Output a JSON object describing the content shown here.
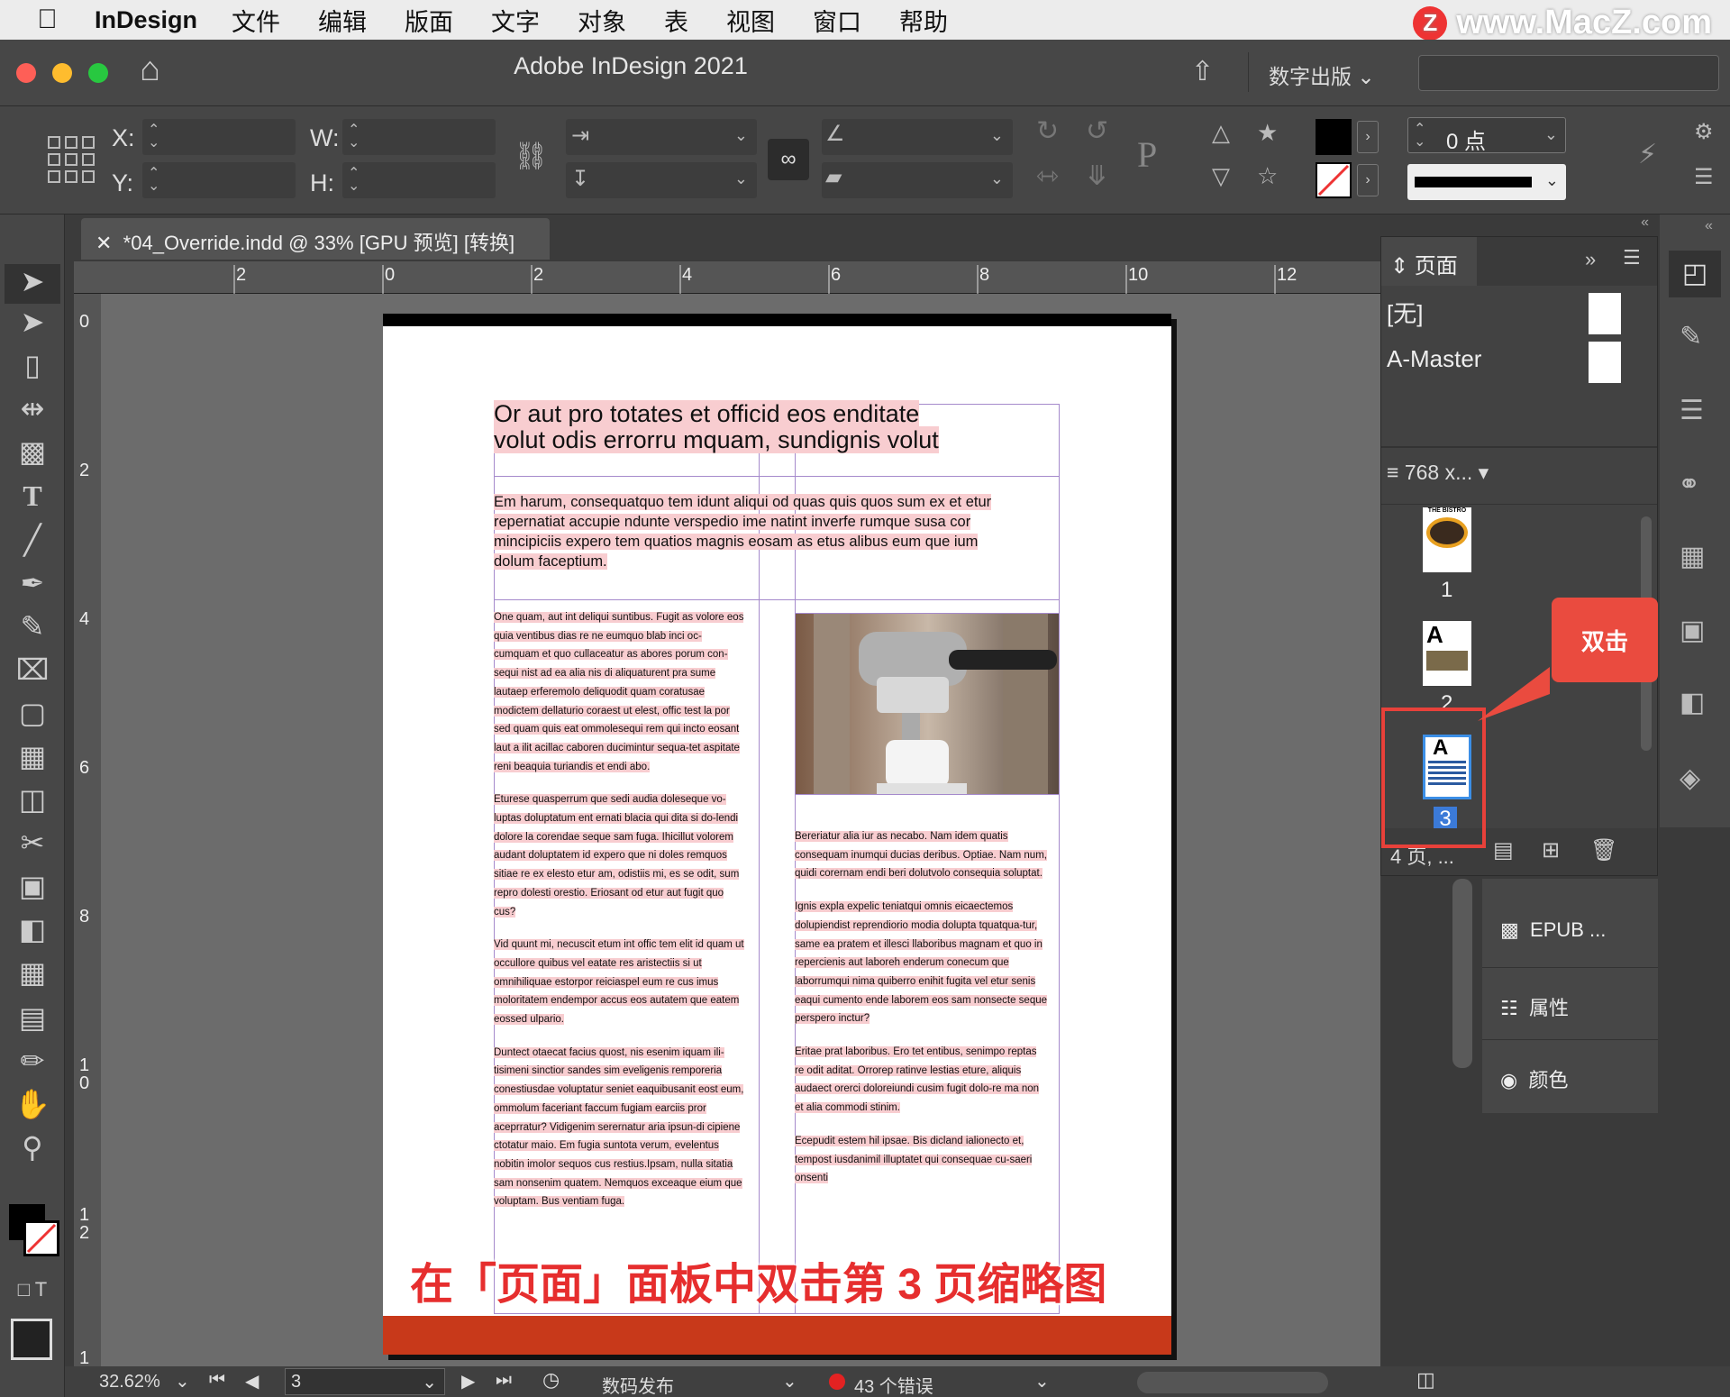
{
  "menubar": {
    "app": "InDesign",
    "items": [
      "文件",
      "编辑",
      "版面",
      "文字",
      "对象",
      "表",
      "视图",
      "窗口",
      "帮助"
    ]
  },
  "watermark": "www.MacZ.com",
  "titlebar": {
    "title": "Adobe InDesign 2021",
    "publish": "数字出版"
  },
  "control": {
    "x_label": "X:",
    "y_label": "Y:",
    "w_label": "W:",
    "h_label": "H:",
    "stroke_weight": "0 点",
    "proxy_letter": "P"
  },
  "document_tab": {
    "title": "*04_Override.indd @ 33% [GPU 预览] [转换]"
  },
  "ruler": {
    "h_labels": [
      "2",
      "0",
      "2",
      "4",
      "6",
      "8",
      "10",
      "12"
    ],
    "v_labels": [
      "0",
      "2",
      "4",
      "6",
      "8",
      "1\n0",
      "1\n2",
      "1"
    ]
  },
  "page": {
    "headline": "Or aut pro totates et officid eos enditate volut odis errorru mquam, sundignis volut",
    "intro": "Em harum, consequatquo tem idunt aliqui od quas quis quos sum ex et etur repernatiat accupie ndunte verspedio ime natint inverfe rumque susa cor mincipiciis expero tem quatios magnis eosam as etus alibus eum que ium dolum faceptium.",
    "col1_paras": [
      "One quam, aut int deliqui suntibus. Fugit as volore eos quia ventibus dias re ne eumquo blab inci oc-cumquam et quo cullaceatur as abores porum con-sequi nist ad ea alia nis di aliquaturent pra sume lautaep erferemolo deliquodit quam coratusae modictem dellaturio coraest ut elest, offic test la por sed quam quis eat ommolesequi rem qui incto eosant laut a ilit acillac caboren ducimintur sequa-tet aspitate reni beaquia turiandis et endi abo.",
      "Eturese quasperrum que sedi audia doleseque vo-luptas doluptatum ent ernati blacia qui dita si do-lendi dolore la corendae seque sam fuga. Ihicillut volorem audant doluptatem id expero que ni doles remquos sitiae re ex elesto etur am, odistiis mi, es se odit, sum repro dolesti orestio. Eriosant od etur aut fugit quo cus?",
      "Vid quunt mi, necuscit etum int offic tem elit id quam ut occullore quibus vel eatate res aristectiis si ut omnihiliquae estorpor reiciaspel eum re cus imus moloritatem endempor accus eos autatem que eatem eossed ulpario.",
      "Duntect otaecat facius quost, nis esenim iquam ili-tisimeni sinctior sandes sim eveligenis remporeria conestiusdae voluptatur seniet eaquibusanit eost eum, ommolum faceriant faccum fugiam earciis pror aceprratur? Vidigenim serernatur aria ipsun-di cipiene ctotatur maio. Em fugia suntota verum, evelentus nobitin imolor sequos cus restius.Ipsam, nulla sitatia sam nonsenim quatem. Nemquos exceaque eium que voluptam. Bus ventiam fuga."
    ],
    "col2_paras": [
      "Bereriatur alia iur as necabo. Nam idem quatis consequam inumqui ducias deribus. Optiae. Nam num, quidi corernam endi beri dolutvolo consequia soluptat.",
      "Ignis expla expelic teniatqui omnis eicaectemos dolupiendist reprendiorio modia dolupta tquatqua-tur, same ea pratem et illesci llaboribus magnam et quo in repercienis aut laboreh enderum conecum que laborrumqui nima quiberro enihit fugita vel etur senis eaqui cumento ende laborem eos sam nonsecte seque perspero inctur?",
      "Eritae prat laboribus. Ero tet entibus, senimpo reptas re odit aditat. Orrorep ratinve lestias eture, aliquis audaect orerci doloreiundi cusim fugit dolo-re ma non et alia commodi stinim.",
      "Ecepudit estem hil ipsae. Bis dicland ialionecto et, tempost iusdanimil illuptatet qui consequae cu-saeri onsenti"
    ]
  },
  "annotation": "在「页面」面板中双击第 3 页缩略图",
  "callout": "双击",
  "pages_panel": {
    "title": "页面",
    "masters": [
      "[无]",
      "A-Master"
    ],
    "size_label": "768 x...",
    "thumbs": [
      {
        "num": "1",
        "label": "THE BISTRO"
      },
      {
        "num": "2"
      },
      {
        "num": "3",
        "selected": true
      }
    ],
    "footer": "4 页, ..."
  },
  "collapsed_panels": [
    "EPUB ...",
    "属性",
    "颜色"
  ],
  "status": {
    "zoom": "32.62%",
    "page": "3",
    "profile": "数码发布",
    "errors": "43 个错误"
  },
  "colors": {
    "accent_red": "#e8413a",
    "banner": "#c8391a",
    "highlight": "#f8cdd0"
  }
}
